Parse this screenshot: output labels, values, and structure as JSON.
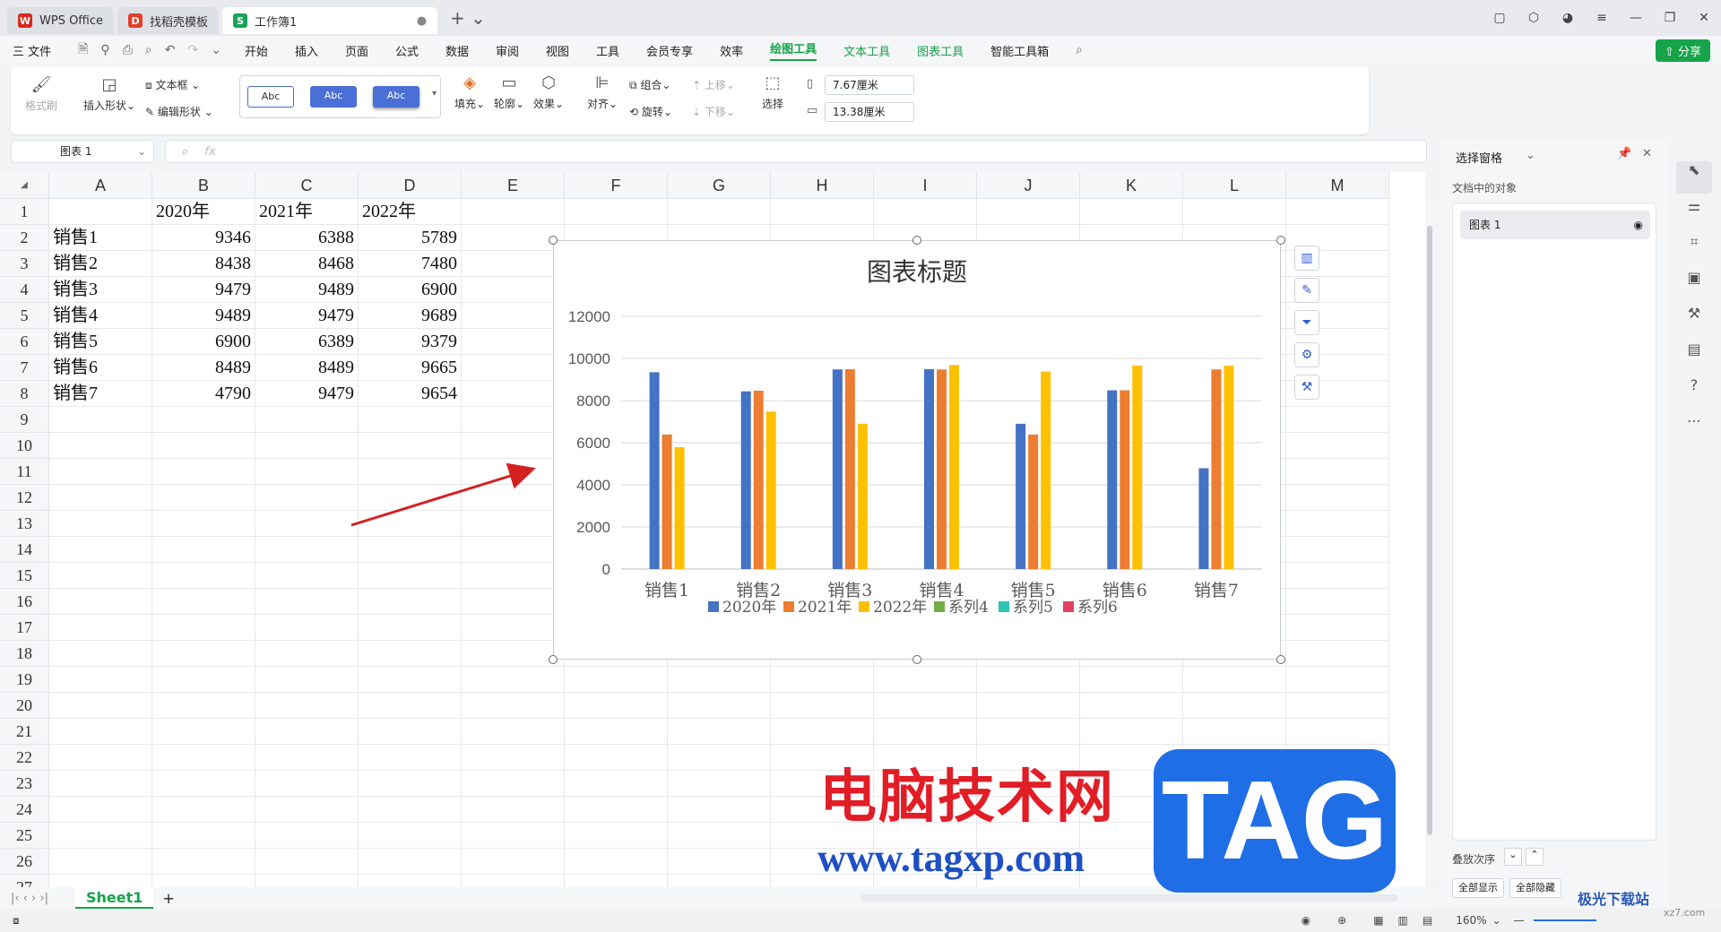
{
  "titlebar": {
    "tabs": [
      {
        "label": "WPS Office",
        "color": "#d9281e"
      },
      {
        "label": "找稻壳模板",
        "color": "#e0402c"
      },
      {
        "label": "工作簿1",
        "color": "#1aa35a"
      }
    ]
  },
  "menubar": {
    "file": "三 文件",
    "items": [
      "开始",
      "插入",
      "页面",
      "公式",
      "数据",
      "审阅",
      "视图",
      "工具",
      "会员专享",
      "效率"
    ],
    "context_items": [
      "绘图工具",
      "文本工具",
      "图表工具"
    ],
    "extra": "智能工具箱",
    "share": "分享"
  },
  "ribbon": {
    "format_painter": "格式刷",
    "insert_shape": "插入形状",
    "text_box": "文本框",
    "edit_shape": "编辑形状",
    "style_preview": "Abc",
    "fill": "填充",
    "outline": "轮廓",
    "effect": "效果",
    "align": "对齐",
    "group": "组合",
    "rotate": "旋转",
    "bring_forward": "上移",
    "send_backward": "下移",
    "select": "选择",
    "width": "7.67厘米",
    "height": "13.38厘米"
  },
  "formula": {
    "name": "图表 1",
    "fx": "fx"
  },
  "sheet": {
    "columns": [
      "A",
      "B",
      "C",
      "D",
      "E",
      "F",
      "G",
      "H",
      "I",
      "J",
      "K",
      "L",
      "M"
    ],
    "rows": [
      "1",
      "2",
      "3",
      "4",
      "5",
      "6",
      "7",
      "8",
      "9",
      "10",
      "11",
      "12",
      "13",
      "14",
      "15",
      "16",
      "17",
      "18",
      "19",
      "20",
      "21",
      "22",
      "23",
      "24",
      "25",
      "26",
      "27"
    ],
    "header_row": [
      "",
      "2020年",
      "2021年",
      "2022年"
    ],
    "data": [
      [
        "销售1",
        "9346",
        "6388",
        "5789"
      ],
      [
        "销售2",
        "8438",
        "8468",
        "7480"
      ],
      [
        "销售3",
        "9479",
        "9489",
        "6900"
      ],
      [
        "销售4",
        "9489",
        "9479",
        "9689"
      ],
      [
        "销售5",
        "6900",
        "6389",
        "9379"
      ],
      [
        "销售6",
        "8489",
        "8489",
        "9665"
      ],
      [
        "销售7",
        "4790",
        "9479",
        "9654"
      ]
    ],
    "tab": "Sheet1"
  },
  "chart_data": {
    "type": "bar",
    "title": "图表标题",
    "categories": [
      "销售1",
      "销售2",
      "销售3",
      "销售4",
      "销售5",
      "销售6",
      "销售7"
    ],
    "series": [
      {
        "name": "2020年",
        "color": "#4472c4",
        "values": [
          9346,
          8438,
          9479,
          9489,
          6900,
          8489,
          4790
        ]
      },
      {
        "name": "2021年",
        "color": "#ed7d31",
        "values": [
          6388,
          8468,
          9489,
          9479,
          6389,
          8489,
          9479
        ]
      },
      {
        "name": "2022年",
        "color": "#ffc000",
        "values": [
          5789,
          7480,
          6900,
          9689,
          9379,
          9665,
          9654
        ]
      }
    ],
    "legend_extra": [
      {
        "name": "系列4",
        "color": "#70ad47"
      },
      {
        "name": "系列5",
        "color": "#2ec4b6"
      },
      {
        "name": "系列6",
        "color": "#e0405e"
      }
    ],
    "yticks": [
      "0",
      "2000",
      "4000",
      "6000",
      "8000",
      "10000",
      "12000"
    ],
    "ylim": [
      0,
      12000
    ],
    "grid": true,
    "legend_position": "bottom"
  },
  "rpane": {
    "title": "选择窗格",
    "subtitle": "文档中的对象",
    "item": "图表 1",
    "order": "叠放次序",
    "show_all": "全部显示",
    "hide_all": "全部隐藏"
  },
  "statusbar": {
    "zoom": "160%"
  },
  "watermark": {
    "cn": "电脑技术网",
    "url": "www.tagxp.com",
    "tag": "TAG",
    "site": "极光下载站",
    "site2": "xz7.com"
  }
}
